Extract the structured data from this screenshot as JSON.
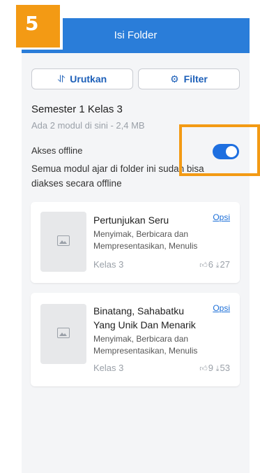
{
  "step": {
    "number": "5"
  },
  "header": {
    "title": "Isi Folder"
  },
  "toolbar": {
    "sort_icon": "⥯",
    "sort_label": "Urutkan",
    "filter_icon": "⚙",
    "filter_label": "Filter"
  },
  "folder": {
    "title": "Semester 1 Kelas 3",
    "meta": "Ada 2 modul di sini - 2,4 MB"
  },
  "offline": {
    "label": "Akses offline",
    "enabled": true,
    "description": "Semua modul ajar di folder ini sudah bisa diakses secara offline"
  },
  "modules": [
    {
      "title": "Pertunjukan Seru",
      "options": "Opsi",
      "subjects": "Menyimak, Berbicara dan Mempresentasikan, Menulis",
      "grade": "Kelas 3",
      "likes": "6",
      "downloads": "27"
    },
    {
      "title": "Binatang, Sahabatku Yang Unik Dan Menarik",
      "options": "Opsi",
      "subjects": "Menyimak, Berbicara dan Mempresentasikan, Menulis",
      "grade": "Kelas 3",
      "likes": "9",
      "downloads": "53"
    }
  ],
  "icons": {
    "like": "thumbs-up-icon",
    "download": "download-icon",
    "image": "image-placeholder-icon"
  },
  "colors": {
    "primary": "#2a7dd9",
    "highlight": "#f39a14",
    "toggle": "#1e6fe0"
  }
}
